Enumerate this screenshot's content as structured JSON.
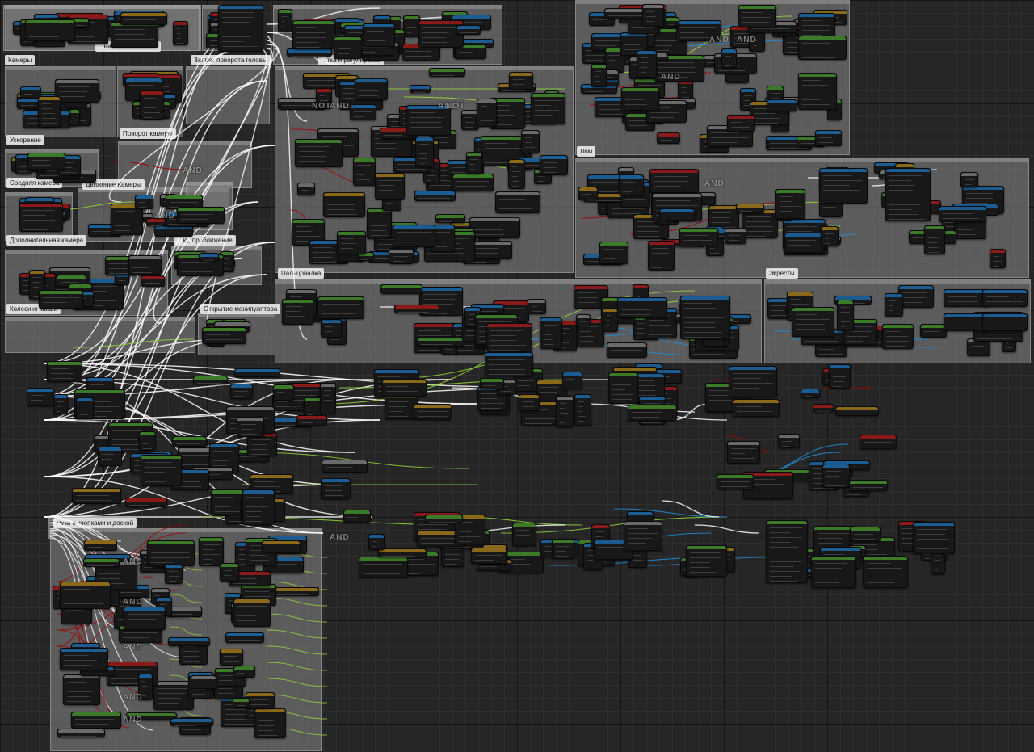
{
  "window": {
    "title": ""
  },
  "colors": {
    "background": "#262626",
    "comment_fill": "#7e7e7e",
    "exec_wire": "#ffffff",
    "bool_wire": "#a00000",
    "float_wire": "#9ade3c",
    "object_wire": "#1f8fd6",
    "event_header": "#8a1a1a",
    "function_header": "#1c5c90",
    "pure_header": "#3c7a2a"
  },
  "comments": [
    {
      "label": "Камеры"
    },
    {
      "label": "...нительных кнопок"
    },
    {
      "label": "Запрет поворота головы"
    },
    {
      "label": "...тка и регулировка"
    },
    {
      "label": "Поворот камеры"
    },
    {
      "label": "Ускорение"
    },
    {
      "label": "Средняя камера"
    },
    {
      "label": "Движение Камеры"
    },
    {
      "label": "Дополнительная камера"
    },
    {
      "label": "...ку, приближение"
    },
    {
      "label": "Колесико мыши"
    },
    {
      "label": "Открытие манипулятора"
    },
    {
      "label": "Пальцовалка"
    },
    {
      "label": "Лом"
    },
    {
      "label": "Экресты"
    },
    {
      "label": "Руки с кнопками и доской"
    }
  ],
  "boolean_ops": [
    {
      "label": "AND"
    },
    {
      "label": "NOT"
    },
    {
      "label": "AND"
    },
    {
      "label": "NOT"
    },
    {
      "label": "AND"
    },
    {
      "label": "AND"
    },
    {
      "label": "AND"
    },
    {
      "label": "AND"
    },
    {
      "label": "AND"
    },
    {
      "label": "AND"
    },
    {
      "label": "AND"
    },
    {
      "label": "AND"
    },
    {
      "label": "AND"
    },
    {
      "label": "AND"
    },
    {
      "label": "AND"
    },
    {
      "label": "AND"
    }
  ]
}
